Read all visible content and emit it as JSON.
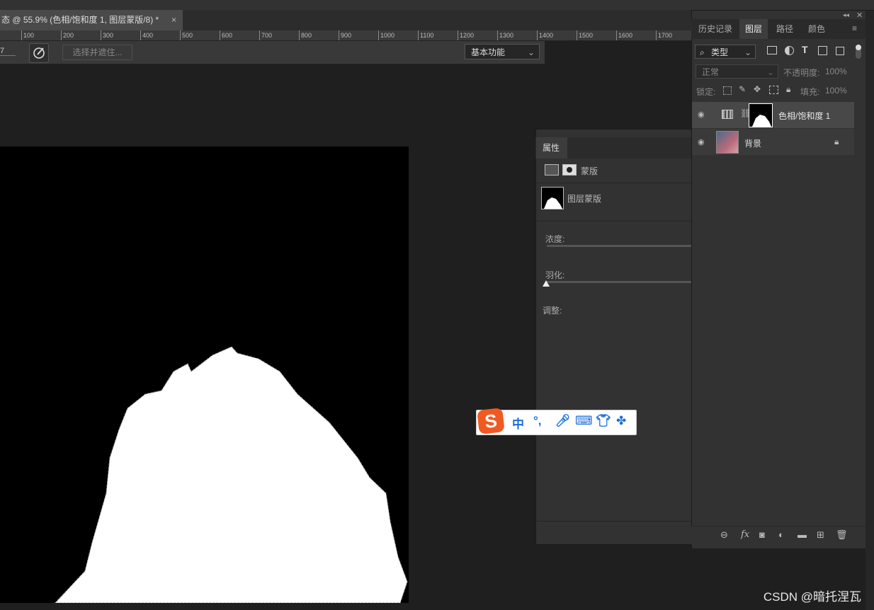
{
  "document_tab": {
    "title": "态 @ 55.9% (色相/饱和度 1, 图层蒙版/8) *",
    "close": "×"
  },
  "ruler": {
    "labels": [
      "100",
      "200",
      "300",
      "400",
      "500",
      "600",
      "700",
      "800",
      "900",
      "1000",
      "1100",
      "1200",
      "1300",
      "1400",
      "1500",
      "1600",
      "1700"
    ]
  },
  "options_bar": {
    "size_value": "7",
    "select_and_mask": "选择并遮住...",
    "workspace": "基本功能"
  },
  "properties": {
    "tab": "属性",
    "mask_type_label": "蒙版",
    "layer_mask_label": "图层蒙版",
    "density_label": "浓度:",
    "feather_label": "羽化:",
    "adjust_label": "调整:"
  },
  "layers_panel": {
    "tabs": [
      "历史记录",
      "图层",
      "路径",
      "颜色"
    ],
    "active_tab": "图层",
    "filter": "类型",
    "blend_mode": "正常",
    "opacity_label": "不透明度:",
    "opacity_value": "100%",
    "lock_label": "锁定:",
    "fill_label": "填充:",
    "fill_value": "100%",
    "layers": [
      {
        "name": "色相/饱和度 1",
        "type": "adjustment"
      },
      {
        "name": "背景",
        "type": "background",
        "locked": true
      }
    ]
  },
  "ime_toolbar": {
    "logo": "S",
    "mode": "中",
    "punct": "°,"
  },
  "watermark": "CSDN @暗托涅瓦"
}
